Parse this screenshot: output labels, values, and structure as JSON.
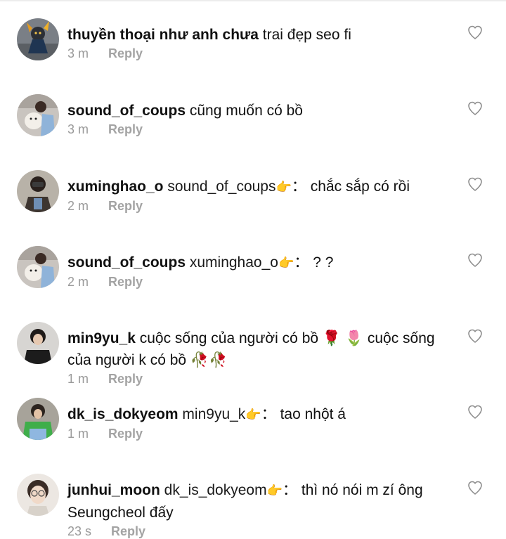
{
  "comments": [
    {
      "username": "thuyền thoại như anh chưa",
      "text": "trai đẹp seo fi",
      "time": "3 m",
      "reply": "Reply",
      "avatar": "warrior-figure-avatar",
      "like_icon": "heart-outline-icon"
    },
    {
      "username": "sound_of_coups",
      "text": "cũng muốn có bồ",
      "time": "3 m",
      "reply": "Reply",
      "avatar": "person-holding-dog-avatar",
      "like_icon": "heart-outline-icon"
    },
    {
      "username": "xuminghao_o",
      "mention": "sound_of_coups",
      "mention_emoji": "👉",
      "separator": "：",
      "text": "chắc sắp có rồi",
      "time": "2 m",
      "reply": "Reply",
      "avatar": "person-with-photo-avatar",
      "like_icon": "heart-outline-icon"
    },
    {
      "username": "sound_of_coups",
      "mention": "xuminghao_o",
      "mention_emoji": "👉",
      "separator": "：",
      "text": "? ?",
      "time": "2 m",
      "reply": "Reply",
      "avatar": "person-holding-dog-avatar",
      "like_icon": "heart-outline-icon"
    },
    {
      "username": "min9yu_k",
      "text": "cuộc sống của người có bồ 🌹 🌷  cuộc sống của người k có bồ 🥀🥀",
      "time": "1 m",
      "reply": "Reply",
      "avatar": "person-dark-shirt-avatar",
      "like_icon": "heart-outline-icon"
    },
    {
      "username": "dk_is_dokyeom",
      "mention": "min9yu_k",
      "mention_emoji": "👉",
      "separator": "：",
      "text": "tao nhột á",
      "time": "1 m",
      "reply": "Reply",
      "avatar": "person-green-jacket-avatar",
      "like_icon": "heart-outline-icon"
    },
    {
      "username": "junhui_moon",
      "mention": "dk_is_dokyeom",
      "mention_emoji": "👉",
      "separator": "：",
      "text": "thì nó nói m zí ông Seungcheol đấy",
      "time": "23 s",
      "reply": "Reply",
      "avatar": "person-glasses-avatar",
      "like_icon": "heart-outline-icon"
    }
  ]
}
